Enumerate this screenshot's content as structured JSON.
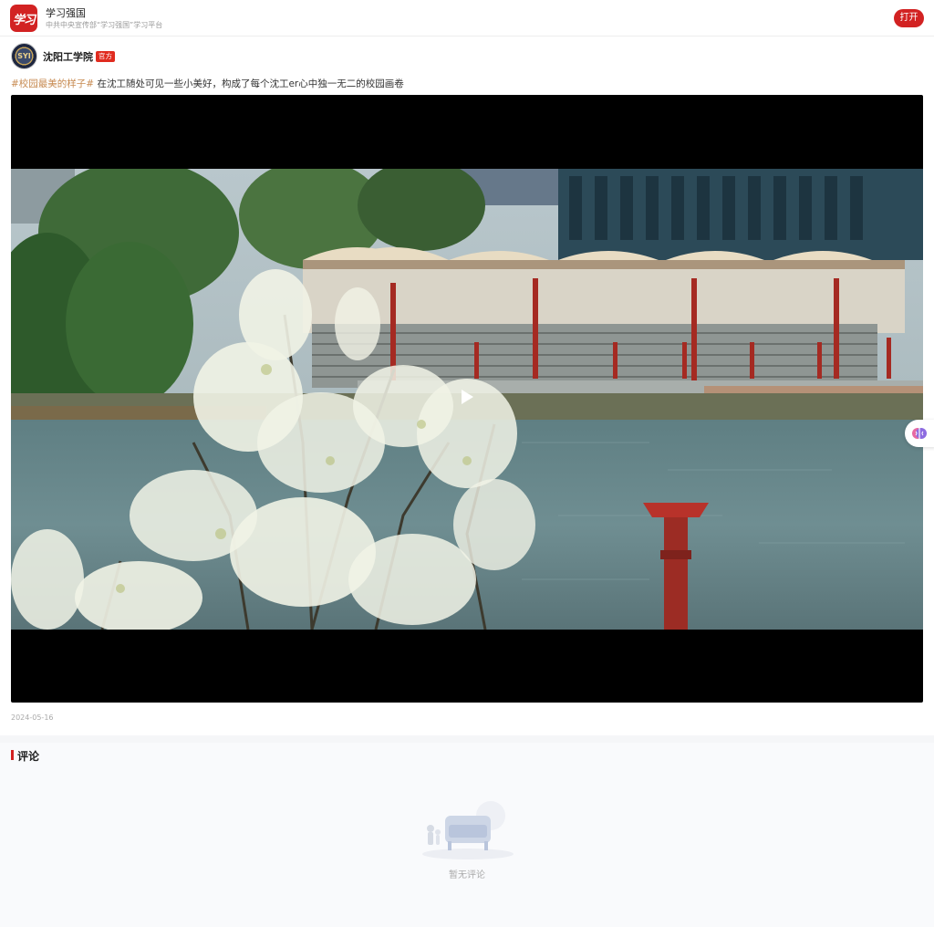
{
  "header": {
    "logo_text": "学习",
    "title": "学习强国",
    "subtitle": "中共中央宣传部“学习强国”学习平台",
    "open_button": "打开"
  },
  "post": {
    "account_name": "沈阳工学院",
    "avatar_text": "SYI",
    "official_badge": "官方",
    "hashtag": "#校园最美的样子#",
    "text": " 在沈工随处可见一些小美好，构成了每个沈工er心中独一无二的校园画卷",
    "date": "2024-05-16",
    "video": {
      "state": "paused",
      "play_icon": "play-icon"
    }
  },
  "comments": {
    "title": "评论",
    "empty_text": "暂无评论"
  },
  "colors": {
    "brand_red": "#d22222",
    "tag_color": "#c78a50"
  }
}
